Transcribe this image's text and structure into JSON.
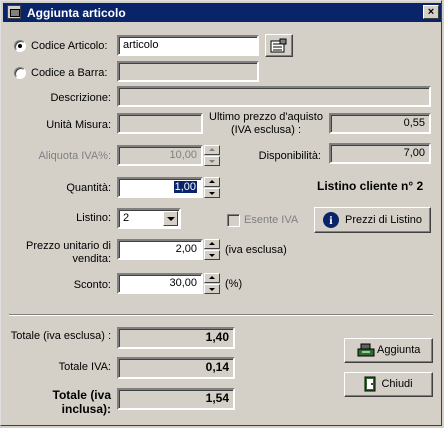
{
  "window": {
    "title": "Aggiunta articolo",
    "close_glyph": "×"
  },
  "codice_articolo": {
    "label": "Codice Articolo:",
    "value": "articolo",
    "selected": true
  },
  "codice_barra": {
    "label": "Codice a Barra:",
    "value": "",
    "selected": false
  },
  "descrizione": {
    "label": "Descrizione:",
    "value": ""
  },
  "unita_misura": {
    "label": "Unità Misura:",
    "value": ""
  },
  "ultimo_prezzo": {
    "label": "Ultimo prezzo d'aquisto (IVA esclusa) :",
    "value": "0,55"
  },
  "aliquota_iva": {
    "label": "Aliquota IVA%:",
    "value": "10,00"
  },
  "disponibilita": {
    "label": "Disponibilità:",
    "value": "7,00"
  },
  "quantita": {
    "label": "Quantità:",
    "value": "1,00"
  },
  "listino_cliente": {
    "text": "Listino cliente n° 2"
  },
  "listino": {
    "label": "Listino:",
    "value": "2"
  },
  "esente_iva": {
    "label": "Esente IVA",
    "checked": false
  },
  "prezzi_listino": {
    "label": "Prezzi di Listino",
    "icon": "info-icon"
  },
  "prezzo_unitario": {
    "label": "Prezzo unitario di vendita:",
    "value": "2,00",
    "suffix": "(iva esclusa)"
  },
  "sconto": {
    "label": "Sconto:",
    "value": "30,00",
    "suffix": "(%)"
  },
  "totali": {
    "esclusa": {
      "label": "Totale (iva esclusa) :",
      "value": "1,40"
    },
    "iva": {
      "label": "Totale IVA:",
      "value": "0,14"
    },
    "inclusa": {
      "label": "Totale (iva inclusa):",
      "value": "1,54"
    }
  },
  "buttons": {
    "aggiunta": {
      "label": "Aggiunta",
      "icon": "cash-register-icon"
    },
    "chiudi": {
      "label": "Chiudi",
      "icon": "exit-door-icon"
    }
  },
  "colors": {
    "titlebar": "#0a246a",
    "face": "#d4d0c8"
  }
}
